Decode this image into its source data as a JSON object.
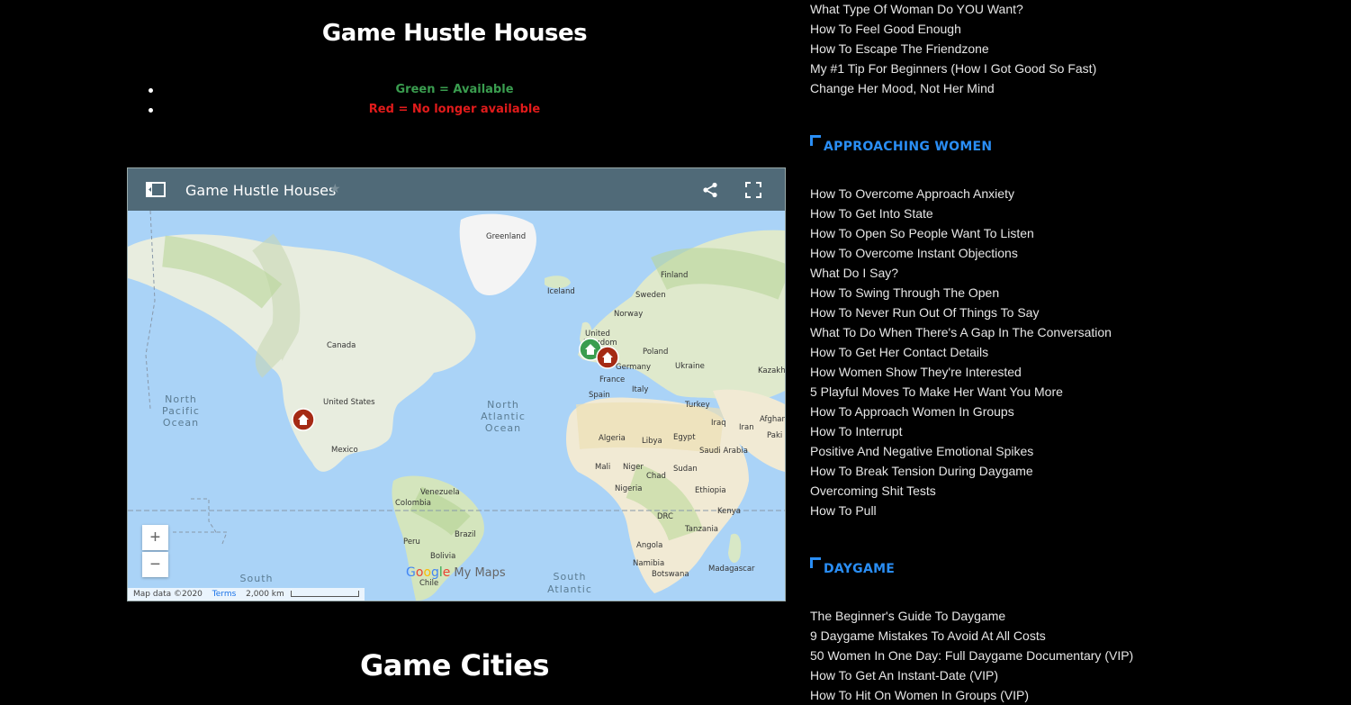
{
  "main": {
    "title": "Game Hustle Houses",
    "legend": [
      {
        "text": "Green = Available",
        "color": "#3a9d4f"
      },
      {
        "text": "Red = No longer available",
        "color": "#e11b1b"
      }
    ],
    "map": {
      "title": "Game Hustle Houses",
      "zoom_in": "+",
      "zoom_out": "−",
      "branding_suffix": "My Maps",
      "attribution": "Map data ©2020",
      "terms": "Terms",
      "scale": "2,000 km",
      "labels": {
        "greenland": "Greenland",
        "iceland": "Iceland",
        "finland": "Finland",
        "sweden": "Sweden",
        "norway": "Norway",
        "united_kingdom_1": "United",
        "united_kingdom_2": "Kingdom",
        "poland": "Poland",
        "germany": "Germany",
        "ukraine": "Ukraine",
        "kazakh": "Kazakh",
        "france": "France",
        "italy": "Italy",
        "spain": "Spain",
        "turkey": "Turkey",
        "iraq": "Iraq",
        "iran": "Iran",
        "afghan": "Afghan",
        "pak": "Paki",
        "canada": "Canada",
        "united_states": "United States",
        "mexico": "Mexico",
        "algeria": "Algeria",
        "libya": "Libya",
        "egypt": "Egypt",
        "saudi": "Saudi Arabia",
        "mali": "Mali",
        "niger": "Niger",
        "chad": "Chad",
        "sudan": "Sudan",
        "nigeria": "Nigeria",
        "ethiopia": "Ethiopia",
        "drc": "DRC",
        "kenya": "Kenya",
        "tanzania": "Tanzania",
        "angola": "Angola",
        "namibia": "Namibia",
        "botswana": "Botswana",
        "madagascar": "Madagascar",
        "venezuela": "Venezuela",
        "colombia": "Colombia",
        "peru": "Peru",
        "brazil": "Brazil",
        "bolivia": "Bolivia",
        "chile": "Chile",
        "np_ocean_1": "North",
        "np_ocean_2": "Pacific",
        "np_ocean_3": "Ocean",
        "na_ocean_1": "North",
        "na_ocean_2": "Atlantic",
        "na_ocean_3": "Ocean",
        "south_1": "South",
        "sa_ocean_1": "South",
        "sa_ocean_2": "Atlantic"
      },
      "markers": [
        {
          "name": "london",
          "status": "available",
          "color": "#3a9d4f"
        },
        {
          "name": "europe-central",
          "status": "unavailable",
          "color": "#a52a14"
        },
        {
          "name": "los-angeles",
          "status": "unavailable",
          "color": "#a52a14"
        }
      ]
    },
    "cities_title": "Game Cities"
  },
  "sidebar": {
    "top_links": [
      "What Type Of Woman Do YOU Want?",
      "How To Feel Good Enough",
      "How To Escape The Friendzone",
      "My #1 Tip For Beginners (How I Got Good So Fast)",
      "Change Her Mood, Not Her Mind"
    ],
    "approaching": {
      "heading": "APPROACHING WOMEN",
      "links": [
        "How To Overcome Approach Anxiety",
        "How To Get Into State",
        "How To Open So People Want To Listen",
        "How To Overcome Instant Objections",
        "What Do I Say?",
        "How To Swing Through The Open",
        "How To Never Run Out Of Things To Say",
        "What To Do When There's A Gap In The Conversation",
        "How To Get Her Contact Details",
        "How Women Show They're Interested",
        "5 Playful Moves To Make Her Want You More",
        "How To Approach Women In Groups",
        "How To Interrupt",
        "Positive And Negative Emotional Spikes",
        "How To Break Tension During Daygame",
        "Overcoming Shit Tests",
        "How To Pull"
      ]
    },
    "daygame": {
      "heading": "DAYGAME",
      "links": [
        "The Beginner's Guide To Daygame",
        "9 Daygame Mistakes To Avoid At All Costs",
        "50 Women In One Day: Full Daygame Documentary (VIP)",
        "How To Get An Instant-Date (VIP)",
        "How To Hit On Women In Groups (VIP)"
      ]
    }
  }
}
